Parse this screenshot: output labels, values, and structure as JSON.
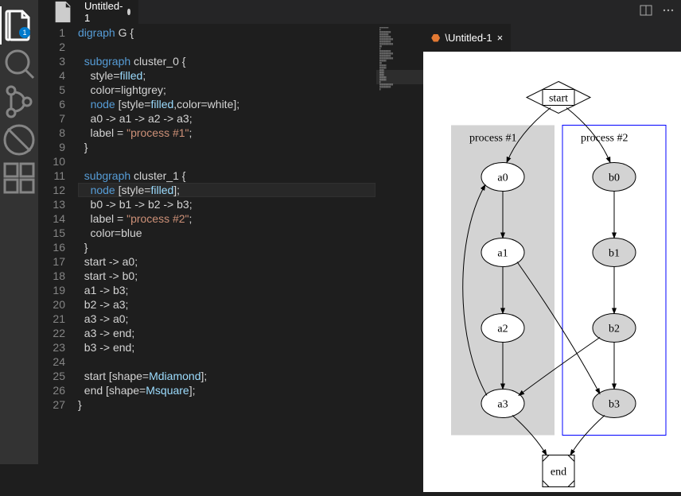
{
  "activityBar": {
    "badge": "1"
  },
  "editorTab": {
    "title": "Untitled-1"
  },
  "previewTab": {
    "title": "\\Untitled-1"
  },
  "code": {
    "lines": [
      {
        "n": "1",
        "seg": [
          {
            "t": "digraph",
            "c": "kw-blue"
          },
          {
            "t": " G {",
            "c": "id"
          }
        ]
      },
      {
        "n": "2",
        "seg": []
      },
      {
        "n": "3",
        "seg": [
          {
            "t": "  ",
            "c": "id"
          },
          {
            "t": "subgraph",
            "c": "kw-blue"
          },
          {
            "t": " cluster_0 {",
            "c": "id"
          }
        ]
      },
      {
        "n": "4",
        "seg": [
          {
            "t": "    style=",
            "c": "id"
          },
          {
            "t": "filled",
            "c": "kw-teal"
          },
          {
            "t": ";",
            "c": "id"
          }
        ]
      },
      {
        "n": "5",
        "seg": [
          {
            "t": "    color=lightgrey;",
            "c": "id"
          }
        ]
      },
      {
        "n": "6",
        "seg": [
          {
            "t": "    ",
            "c": "id"
          },
          {
            "t": "node",
            "c": "kw-blue"
          },
          {
            "t": " [style=",
            "c": "id"
          },
          {
            "t": "filled",
            "c": "kw-teal"
          },
          {
            "t": ",color=white];",
            "c": "id"
          }
        ]
      },
      {
        "n": "7",
        "seg": [
          {
            "t": "    a0 -> a1 -> a2 -> a3;",
            "c": "id"
          }
        ]
      },
      {
        "n": "8",
        "seg": [
          {
            "t": "    label = ",
            "c": "id"
          },
          {
            "t": "\"process #1\"",
            "c": "str"
          },
          {
            "t": ";",
            "c": "id"
          }
        ]
      },
      {
        "n": "9",
        "seg": [
          {
            "t": "  }",
            "c": "id"
          }
        ]
      },
      {
        "n": "10",
        "seg": []
      },
      {
        "n": "11",
        "seg": [
          {
            "t": "  ",
            "c": "id"
          },
          {
            "t": "subgraph",
            "c": "kw-blue"
          },
          {
            "t": " cluster_1 {",
            "c": "id"
          }
        ]
      },
      {
        "n": "12",
        "seg": [
          {
            "t": "    ",
            "c": "id"
          },
          {
            "t": "node",
            "c": "kw-blue"
          },
          {
            "t": " [style=",
            "c": "id"
          },
          {
            "t": "fil",
            "c": "kw-teal"
          },
          {
            "t": "led",
            "c": "kw-teal"
          },
          {
            "t": "];",
            "c": "id"
          }
        ],
        "current": true
      },
      {
        "n": "13",
        "seg": [
          {
            "t": "    b0 -> b1 -> b2 -> b3;",
            "c": "id"
          }
        ]
      },
      {
        "n": "14",
        "seg": [
          {
            "t": "    label = ",
            "c": "id"
          },
          {
            "t": "\"process #2\"",
            "c": "str"
          },
          {
            "t": ";",
            "c": "id"
          }
        ]
      },
      {
        "n": "15",
        "seg": [
          {
            "t": "    color=blue",
            "c": "id"
          }
        ]
      },
      {
        "n": "16",
        "seg": [
          {
            "t": "  }",
            "c": "id"
          }
        ]
      },
      {
        "n": "17",
        "seg": [
          {
            "t": "  start -> a0;",
            "c": "id"
          }
        ]
      },
      {
        "n": "18",
        "seg": [
          {
            "t": "  start -> b0;",
            "c": "id"
          }
        ]
      },
      {
        "n": "19",
        "seg": [
          {
            "t": "  a1 -> b3;",
            "c": "id"
          }
        ]
      },
      {
        "n": "20",
        "seg": [
          {
            "t": "  b2 -> a3;",
            "c": "id"
          }
        ]
      },
      {
        "n": "21",
        "seg": [
          {
            "t": "  a3 -> a0;",
            "c": "id"
          }
        ]
      },
      {
        "n": "22",
        "seg": [
          {
            "t": "  a3 -> end;",
            "c": "id"
          }
        ]
      },
      {
        "n": "23",
        "seg": [
          {
            "t": "  b3 -> end;",
            "c": "id"
          }
        ]
      },
      {
        "n": "24",
        "seg": []
      },
      {
        "n": "25",
        "seg": [
          {
            "t": "  start [shape=",
            "c": "id"
          },
          {
            "t": "Mdiamond",
            "c": "kw-teal"
          },
          {
            "t": "];",
            "c": "id"
          }
        ]
      },
      {
        "n": "26",
        "seg": [
          {
            "t": "  end [shape=",
            "c": "id"
          },
          {
            "t": "Msquare",
            "c": "kw-teal"
          },
          {
            "t": "];",
            "c": "id"
          }
        ]
      },
      {
        "n": "27",
        "seg": [
          {
            "t": "}",
            "c": "id"
          }
        ]
      }
    ]
  },
  "graph": {
    "cluster1": {
      "label": "process #1",
      "bg": "#d3d3d3"
    },
    "cluster2": {
      "label": "process #2",
      "border": "#0000ff"
    },
    "nodes": {
      "start": "start",
      "a0": "a0",
      "a1": "a1",
      "a2": "a2",
      "a3": "a3",
      "b0": "b0",
      "b1": "b1",
      "b2": "b2",
      "b3": "b3",
      "end": "end"
    }
  }
}
